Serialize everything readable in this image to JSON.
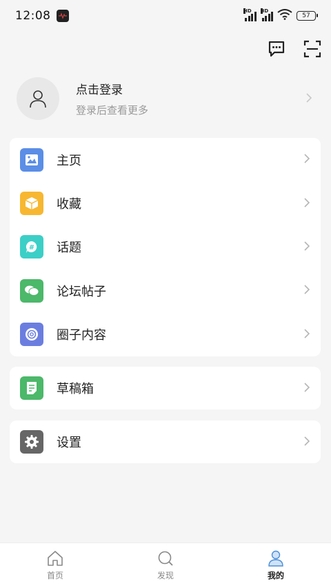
{
  "status_bar": {
    "time": "12:08",
    "signal_label": "HD",
    "battery": "57"
  },
  "profile": {
    "title": "点击登录",
    "subtitle": "登录后查看更多"
  },
  "menu_group_1": [
    {
      "label": "主页",
      "icon": "image-icon",
      "color": "#5b8ee6"
    },
    {
      "label": "收藏",
      "icon": "box-icon",
      "color": "#f7b731"
    },
    {
      "label": "话题",
      "icon": "hashtag-icon",
      "color": "#3ccfc7"
    },
    {
      "label": "论坛帖子",
      "icon": "chat-bubbles-icon",
      "color": "#4cb86a"
    },
    {
      "label": "圈子内容",
      "icon": "circle-icon",
      "color": "#6b7ee0"
    }
  ],
  "menu_group_2": [
    {
      "label": "草稿箱",
      "icon": "draft-icon",
      "color": "#4cb86a"
    }
  ],
  "menu_group_3": [
    {
      "label": "设置",
      "icon": "gear-icon",
      "color": "#666666"
    }
  ],
  "tabbar": [
    {
      "label": "首页",
      "icon": "home-icon"
    },
    {
      "label": "发现",
      "icon": "search-icon"
    },
    {
      "label": "我的",
      "icon": "person-icon",
      "active": true
    }
  ]
}
